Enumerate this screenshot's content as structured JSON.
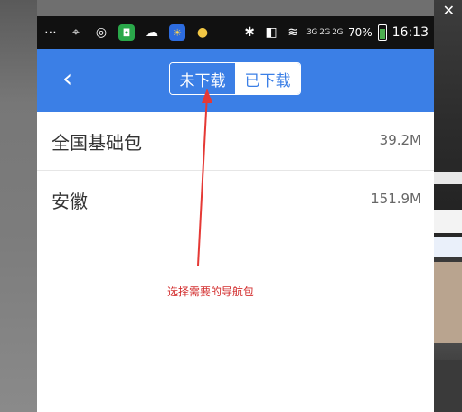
{
  "status_bar": {
    "percent": "70%",
    "time": "16:13",
    "network": "3G 2G 2G"
  },
  "header": {
    "back_icon": "chevron-left-icon",
    "tabs": [
      {
        "label": "未下载",
        "active": true
      },
      {
        "label": "已下载",
        "active": false
      }
    ]
  },
  "packages": [
    {
      "name": "全国基础包",
      "size": "39.2M"
    },
    {
      "name": "安徽",
      "size": "151.9M"
    }
  ],
  "annotation": {
    "text": "选择需要的导航包",
    "color": "#d32f2f"
  },
  "colors": {
    "accent": "#3b7fe6"
  }
}
